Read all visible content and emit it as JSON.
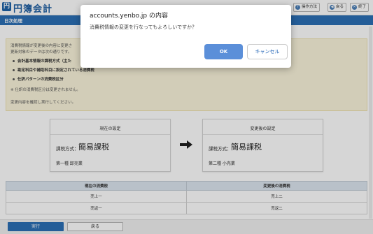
{
  "app": {
    "title": "円簿会計",
    "logo_glyph": "円",
    "buttons": [
      {
        "label": "操作方法",
        "icon": "question-icon",
        "glyph": "?"
      },
      {
        "label": "戻る",
        "icon": "back-arrow-icon",
        "glyph": "◀"
      },
      {
        "label": "終了",
        "icon": "close-icon",
        "glyph": "✕"
      }
    ]
  },
  "nav": {
    "label": "日次処理"
  },
  "notice": {
    "line1": "消費税情報が変更後の内容に変更さ",
    "line2": "更新対象のデータは次の通りです。",
    "bullets": [
      "会計基本情報の課税方式（主た",
      "勘定科目や補助科目に設定されている消費税",
      "仕訳パターンの消費税区分"
    ],
    "note": "※ 仕訳の消費税区分は変更されません。",
    "confirm": "変更内容を確認し実行してください。"
  },
  "current": {
    "title": "現在の設定",
    "tax_label": "課税方式：",
    "tax_value": "簡易課税",
    "industry": "第一種 卸売業"
  },
  "after": {
    "title": "変更後の設定",
    "tax_label": "課税方式：",
    "tax_value": "簡易課税",
    "industry": "第二種 小売業"
  },
  "table": {
    "headers": [
      "現在の消費税",
      "変更後の消費税"
    ],
    "rows": [
      [
        "売上一",
        "売上二"
      ],
      [
        "売返一",
        "売返二"
      ]
    ]
  },
  "footer": {
    "execute": "実行",
    "back": "戻る"
  },
  "dialog": {
    "title": "accounts.yenbo.jp の内容",
    "message": "消費税情報の変更を行なってもよろしいですか？",
    "ok": "OK",
    "cancel": "キャンセル"
  },
  "colors": {
    "accent": "#2b6fb5",
    "dialog_ok": "#5b8fd9",
    "notice_bg": "#fbf5dc"
  }
}
